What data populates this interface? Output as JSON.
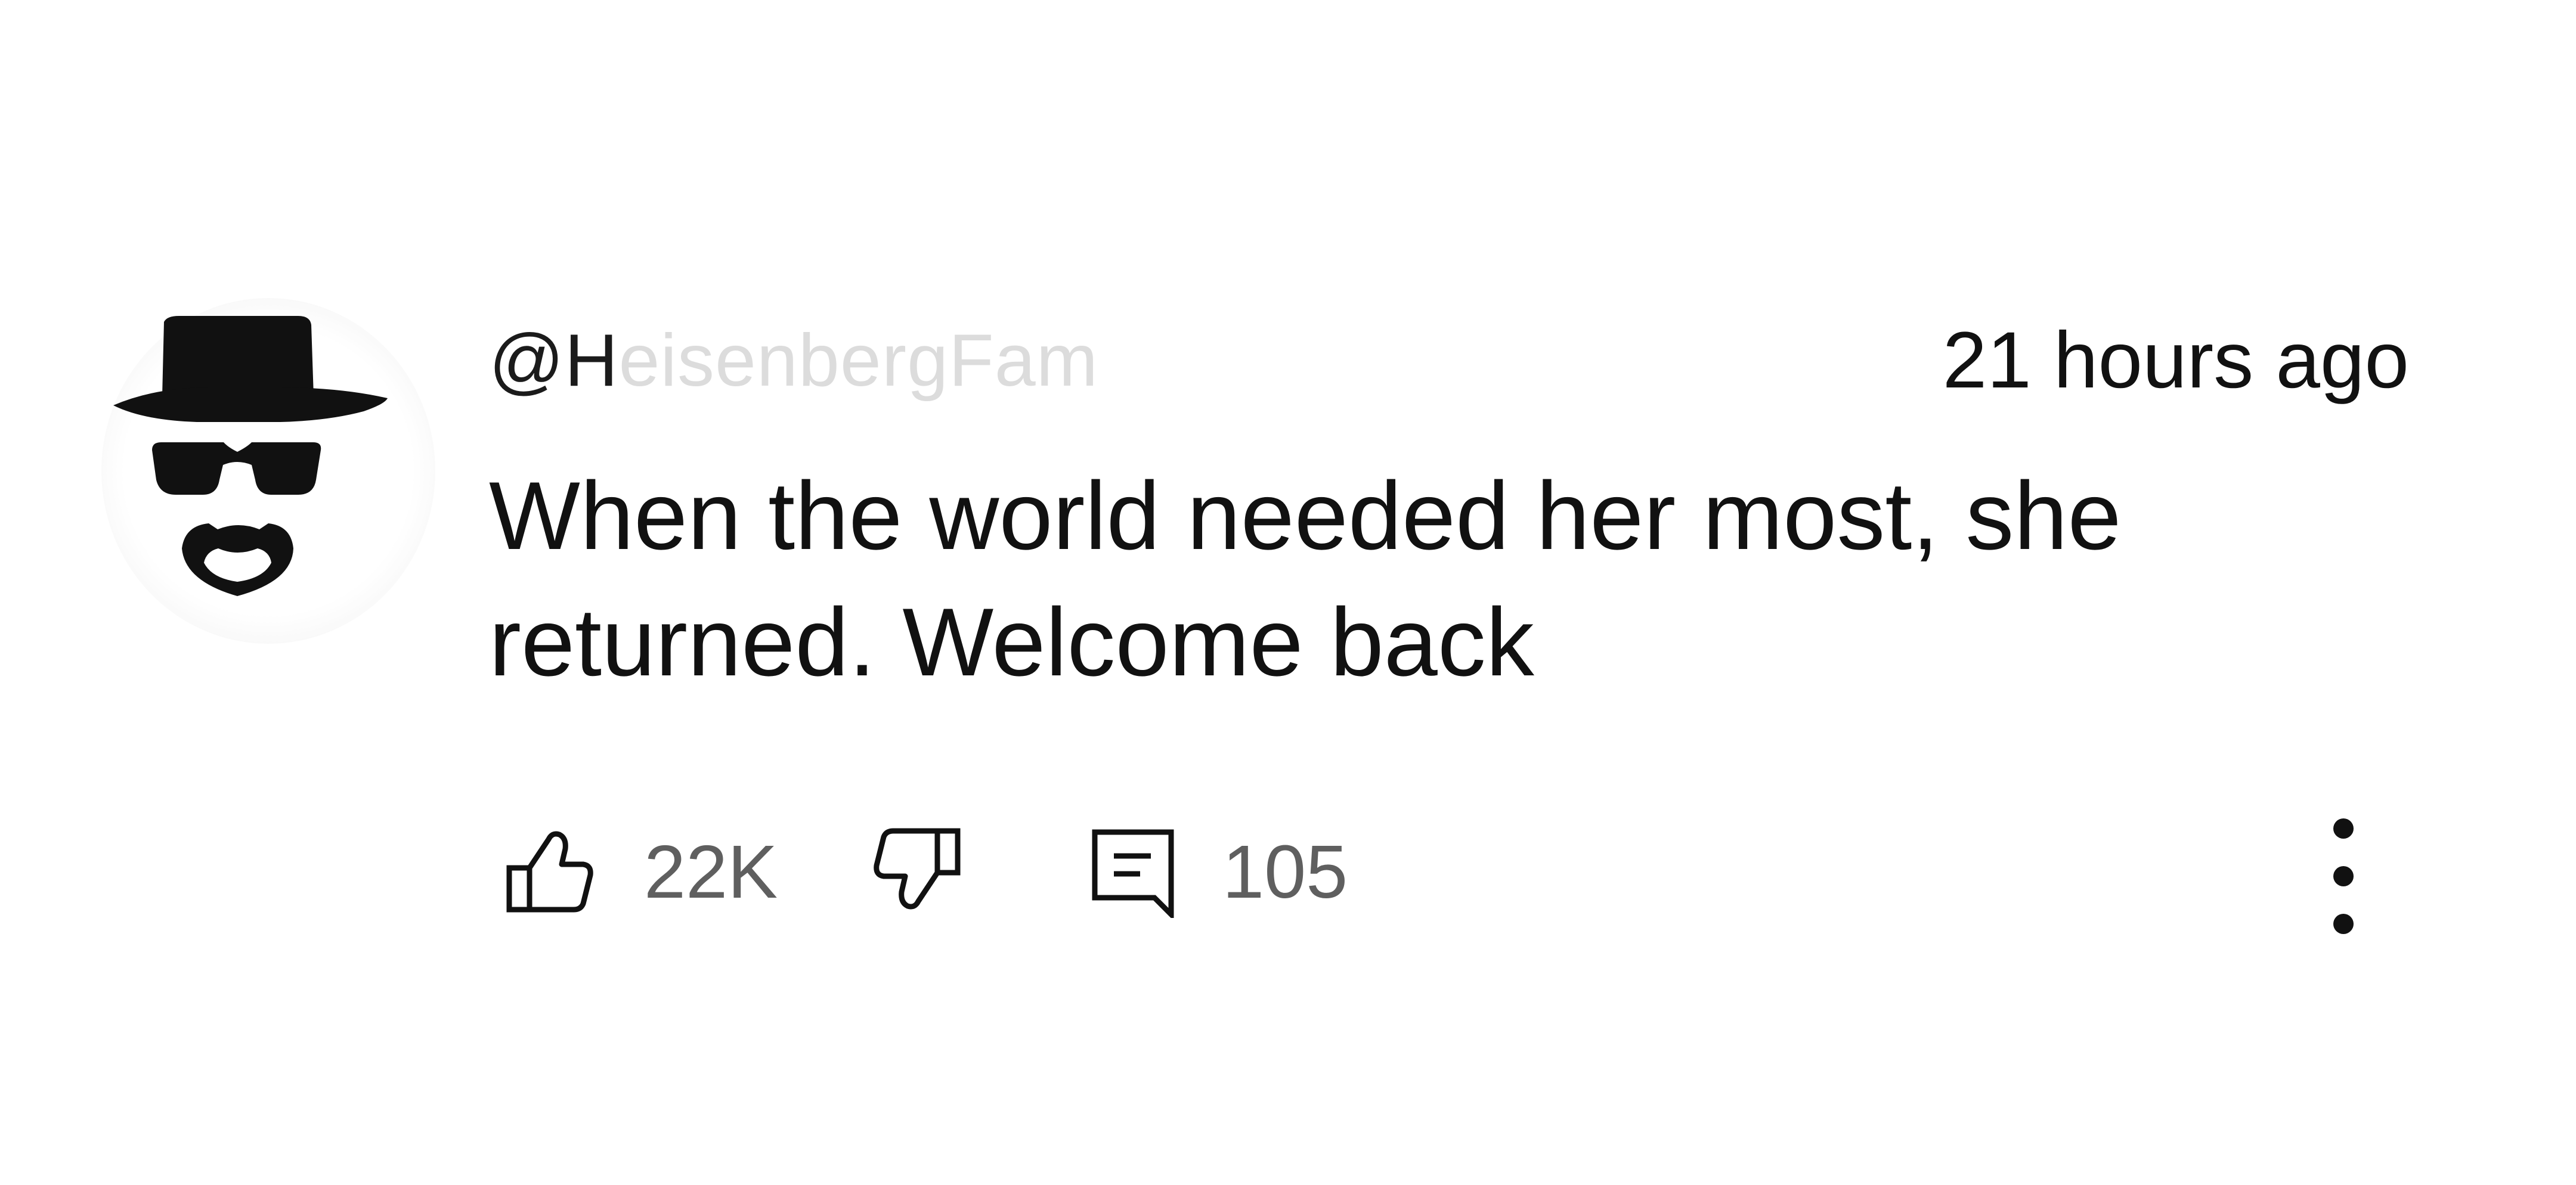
{
  "comment": {
    "username_visible": "@H",
    "username_faded": "eisenbergFam",
    "timestamp": "21 hours ago",
    "text_lines": [
      "When the world needed her most, she",
      "returned. Welcome back"
    ],
    "like_count": "22K",
    "reply_count": "105",
    "avatar_icon": "heisenberg-icon"
  },
  "icons": {
    "like": "thumbs-up-icon",
    "dislike": "thumbs-down-icon",
    "reply": "comment-icon",
    "more": "more-vertical-icon"
  },
  "colors": {
    "text": "#111111",
    "muted_text": "#5f5f5f",
    "faded_username": "#dcdcdc",
    "background": "#ffffff"
  }
}
